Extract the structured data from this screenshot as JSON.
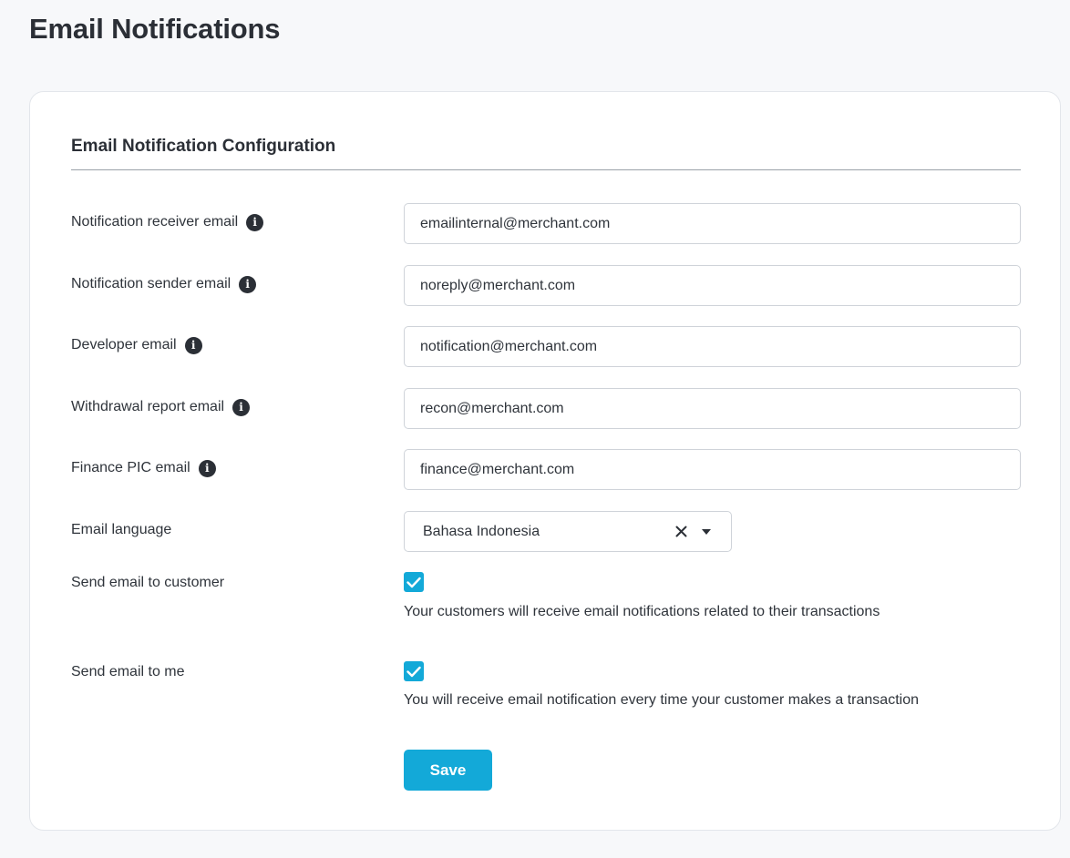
{
  "page": {
    "title": "Email Notifications"
  },
  "section": {
    "title": "Email Notification Configuration"
  },
  "fields": {
    "receiver": {
      "label": "Notification receiver email",
      "value": "emailinternal@merchant.com",
      "icon": "info-icon"
    },
    "sender": {
      "label": "Notification sender email",
      "value": "noreply@merchant.com",
      "icon": "info-icon"
    },
    "developer": {
      "label": "Developer email",
      "value": "notification@merchant.com",
      "icon": "info-icon"
    },
    "withdrawal": {
      "label": "Withdrawal report email",
      "value": "recon@merchant.com",
      "icon": "info-icon"
    },
    "finance": {
      "label": "Finance PIC email",
      "value": "finance@merchant.com",
      "icon": "info-icon"
    }
  },
  "language": {
    "label": "Email language",
    "selected": "Bahasa Indonesia"
  },
  "send_to_customer": {
    "label": "Send email to customer",
    "checked": true,
    "help": "Your customers will receive email notifications related to their transactions"
  },
  "send_to_me": {
    "label": "Send email to me",
    "checked": true,
    "help": "You will receive email notification every time your customer makes a transaction"
  },
  "actions": {
    "save_label": "Save"
  },
  "colors": {
    "accent": "#13a9d8",
    "background": "#f7f8fa",
    "card": "#ffffff",
    "text": "#2b2f36"
  },
  "info_glyph": "i"
}
